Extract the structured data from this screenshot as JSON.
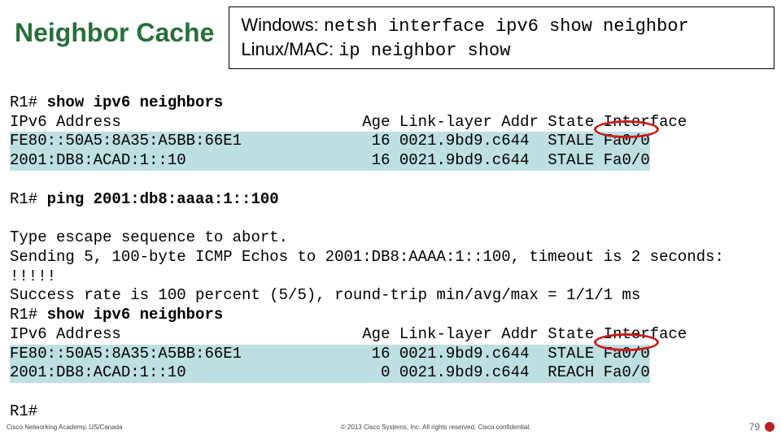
{
  "title": "Neighbor Cache",
  "cmdbox": {
    "win_label": "Windows: ",
    "win_cmd": "netsh interface ipv6 show neighbor",
    "nix_label": "Linux/MAC: ",
    "nix_cmd": "ip neighbor show"
  },
  "term": {
    "prompt1": "R1# ",
    "cmd1": "show ipv6 neighbors",
    "hdr": "IPv6 Address                          Age Link-layer Addr State Interface",
    "row1": "FE80::50A5:8A35:A5BB:66E1              16 0021.9bd9.c644  STALE Fa0/0",
    "row2": "2001:DB8:ACAD:1::10                    16 0021.9bd9.c644  STALE Fa0/0",
    "blank": " ",
    "prompt2": "R1# ",
    "cmd2": "ping 2001:db8:aaaa:1::100",
    "l1": "Type escape sequence to abort.",
    "l2": "Sending 5, 100-byte ICMP Echos to 2001:DB8:AAAA:1::100, timeout is 2 seconds:",
    "l3": "!!!!!",
    "l4": "Success rate is 100 percent (5/5), round-trip min/avg/max = 1/1/1 ms",
    "prompt3": "R1# ",
    "cmd3": "show ipv6 neighbors",
    "hdr2": "IPv6 Address                          Age Link-layer Addr State Interface",
    "row3": "FE80::50A5:8A35:A5BB:66E1              16 0021.9bd9.c644  STALE Fa0/0",
    "row4": "2001:DB8:ACAD:1::10                     0 0021.9bd9.c644  REACH Fa0/0",
    "prompt4": "R1#"
  },
  "footer": {
    "left": "Cisco Networking Academy, US/Canada",
    "center": "© 2013 Cisco Systems, Inc. All rights reserved.  Cisco confidential.",
    "page": "79"
  }
}
